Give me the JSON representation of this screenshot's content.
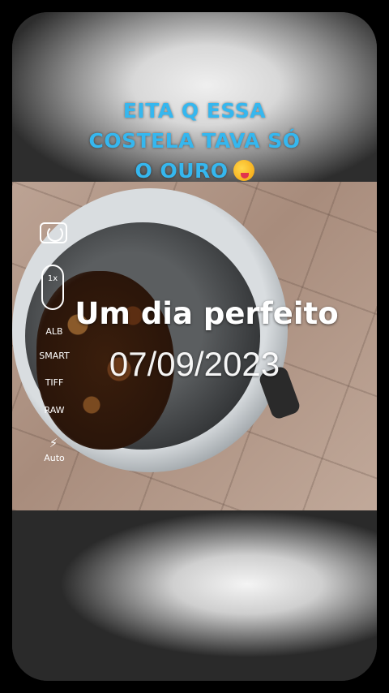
{
  "banner": {
    "line1": "EITA Q ESSA",
    "line2": "COSTELA TAVA SÓ",
    "line3": "O OURO",
    "emoji": "face-savoring-food-emoji",
    "color": "#35b7ef"
  },
  "camera": {
    "switch_icon": "camera-switch-icon",
    "zoom": "1x",
    "options": [
      "ALB",
      "SMART",
      "TIFF",
      "RAW"
    ],
    "flash_icon": "flash-icon",
    "flash_label": "Auto"
  },
  "overlay": {
    "title": "Um dia perfeito",
    "date": "07/09/2023"
  }
}
